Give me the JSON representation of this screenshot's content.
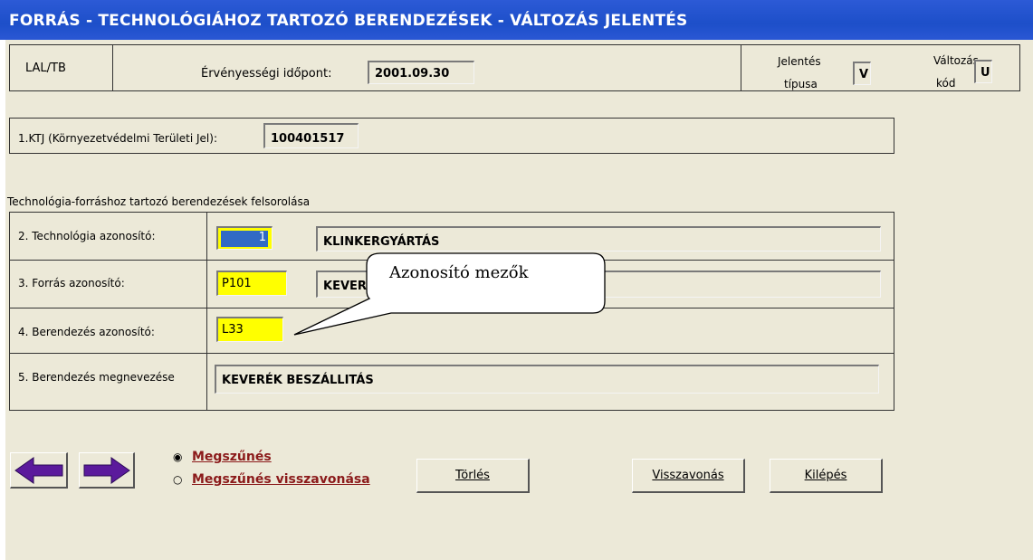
{
  "window": {
    "title": "FORRÁS - TECHNOLÓGIÁHOZ TARTOZÓ BERENDEZÉSEK - VÁLTOZÁS JELENTÉS"
  },
  "header": {
    "code": "LAL/TB",
    "validity_label": "Érvényességi időpont:",
    "validity_value": "2001.09.30",
    "report_type_label_1": "Jelentés",
    "report_type_label_2": "típusa",
    "report_type_value": "V",
    "change_code_label_1": "Változás",
    "change_code_label_2": "kód",
    "change_code_value": "U"
  },
  "ktj": {
    "label": "1.KTJ (Környezetvédelmi Területi Jel):",
    "value": "100401517"
  },
  "section_title": "Technológia-forráshoz tartozó berendezések felsorolása",
  "rows": {
    "technology": {
      "label": "2. Technológia azonosító:",
      "id": "1",
      "name": "KLINKERGYÁRTÁS"
    },
    "source": {
      "label": "3. Forrás azonosító:",
      "id": "P101",
      "name": "KEVERÉK"
    },
    "equipment": {
      "label": "4. Berendezés azonosító:",
      "id": "L33"
    },
    "equipment_name": {
      "label": "5. Berendezés megnevezése",
      "value": "KEVERÉK BESZÁLLITÁS"
    }
  },
  "callout": {
    "text": "Azonosító mezők"
  },
  "options": {
    "terminate": "Megszűnés",
    "terminate_revoke": "Megszűnés visszavonása",
    "selected": "terminate"
  },
  "buttons": {
    "delete": "Törlés",
    "revoke": "Visszavonás",
    "exit": "Kilépés"
  },
  "colors": {
    "title_bar": "#1d4fc9",
    "window_bg": "#ece9d8",
    "id_field": "#ffff00",
    "option_text": "#8b1a1a",
    "nav_arrow": "#5b1a9c"
  }
}
